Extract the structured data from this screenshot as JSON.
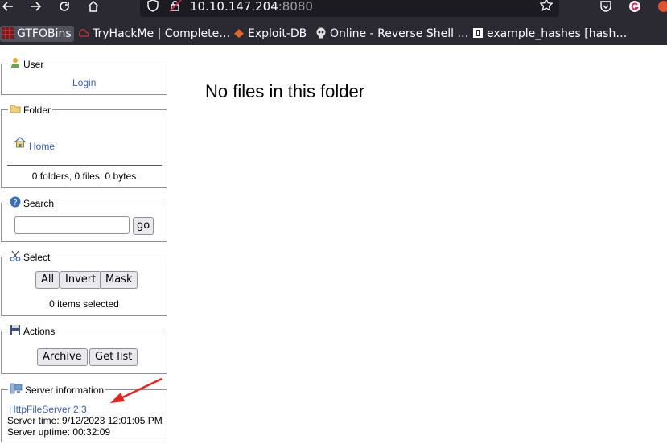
{
  "browser": {
    "url_host": "10.10.147.204",
    "url_port": ":8080",
    "bookmarks": [
      {
        "label": "GTFOBins",
        "icon": "gtfobins-icon"
      },
      {
        "label": "TryHackMe | Complete…",
        "icon": "tryhackme-icon"
      },
      {
        "label": "Exploit-DB",
        "icon": "exploit-db-icon"
      },
      {
        "label": "Online - Reverse Shell …",
        "icon": "skull-icon"
      },
      {
        "label": "example_hashes [hash…",
        "icon": "hashcat-icon"
      }
    ]
  },
  "sidebar": {
    "user": {
      "title": "User",
      "login_link": "Login"
    },
    "folder": {
      "title": "Folder",
      "home_link": "Home",
      "summary": "0 folders, 0 files, 0 bytes"
    },
    "search": {
      "title": "Search",
      "go_label": "go",
      "query": ""
    },
    "select": {
      "title": "Select",
      "all_label": "All",
      "invert_label": "Invert",
      "mask_label": "Mask",
      "status": "0 items selected"
    },
    "actions": {
      "title": "Actions",
      "archive_label": "Archive",
      "getlist_label": "Get list"
    },
    "server": {
      "title": "Server information",
      "version_link": "HttpFileServer 2.3",
      "server_time": "Server time: 9/12/2023 12:01:05 PM",
      "server_uptime": "Server uptime: 00:32:09"
    }
  },
  "main": {
    "message": "No files in this folder"
  },
  "colors": {
    "annotation_arrow": "#e8231f",
    "link": "#3b5eb9",
    "toolbar_bg": "#2b2a33"
  }
}
